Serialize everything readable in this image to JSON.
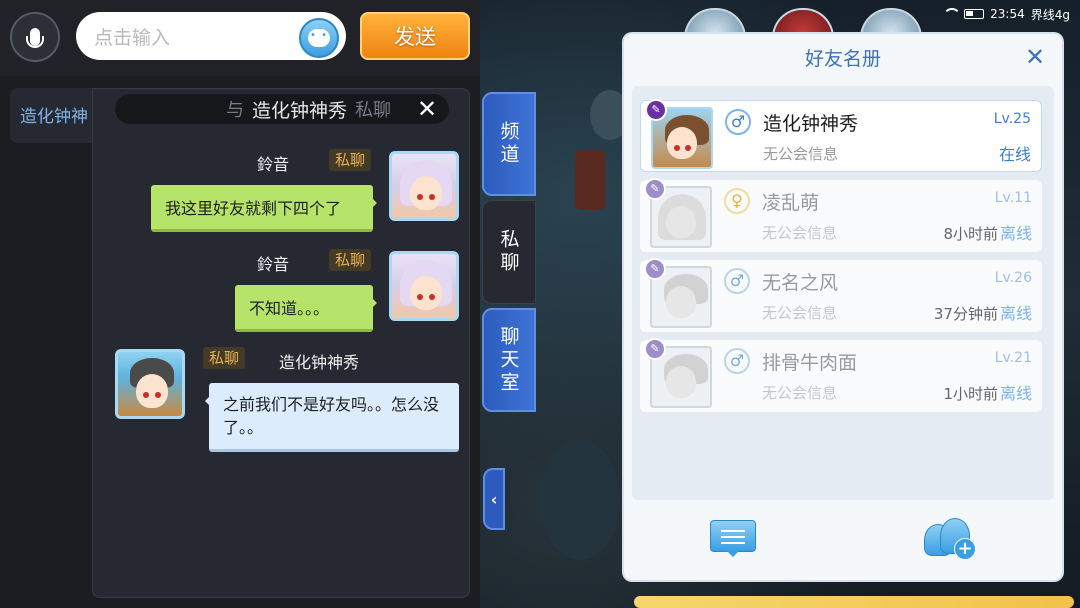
{
  "status_bar": {
    "time": "23:54",
    "carrier": "界线4g"
  },
  "chat": {
    "input_placeholder": "点击输入",
    "send_label": "发送",
    "sidebar_contact": "造化钟神",
    "private_header": {
      "prefix": "与",
      "name": "造化钟神秀",
      "suffix": "私聊"
    },
    "messages": [
      {
        "sender": "鈴音",
        "tag": "私聊",
        "text": "我这里好友就剩下四个了",
        "side": "right"
      },
      {
        "sender": "鈴音",
        "tag": "私聊",
        "text": "不知道。。。",
        "side": "right"
      },
      {
        "sender": "造化钟神秀",
        "tag": "私聊",
        "text": "之前我们不是好友吗。。怎么没了。。",
        "side": "left"
      }
    ]
  },
  "tabs": [
    {
      "label": "频道",
      "active": false
    },
    {
      "label": "私聊",
      "active": true
    },
    {
      "label": "聊天室",
      "active": false
    }
  ],
  "friends_panel": {
    "title": "好友名册",
    "friends": [
      {
        "name": "造化钟神秀",
        "gender": "♂",
        "guild": "无公会信息",
        "level": "Lv.25",
        "last_seen": "",
        "status": "在线",
        "online": true
      },
      {
        "name": "凌乱萌",
        "gender": "♀",
        "guild": "无公会信息",
        "level": "Lv.11",
        "last_seen": "8小时前",
        "status": "离线",
        "online": false
      },
      {
        "name": "无名之风",
        "gender": "♂",
        "guild": "无公会信息",
        "level": "Lv.26",
        "last_seen": "37分钟前",
        "status": "离线",
        "online": false
      },
      {
        "name": "排骨牛肉面",
        "gender": "♂",
        "guild": "无公会信息",
        "level": "Lv.21",
        "last_seen": "1小时前",
        "status": "离线",
        "online": false
      }
    ]
  },
  "icons": {
    "mic": "mic-icon",
    "emoji": "emoji-icon",
    "close": "close-icon",
    "collapse": "chevron-left-icon",
    "message": "message-icon",
    "add_friend": "add-friend-icon"
  },
  "colors": {
    "send_button": "#f08412",
    "accent_blue": "#3e72b9",
    "online": "#3d7fcf",
    "bubble_self": "#b6e36a",
    "bubble_other": "#dcecfc"
  }
}
